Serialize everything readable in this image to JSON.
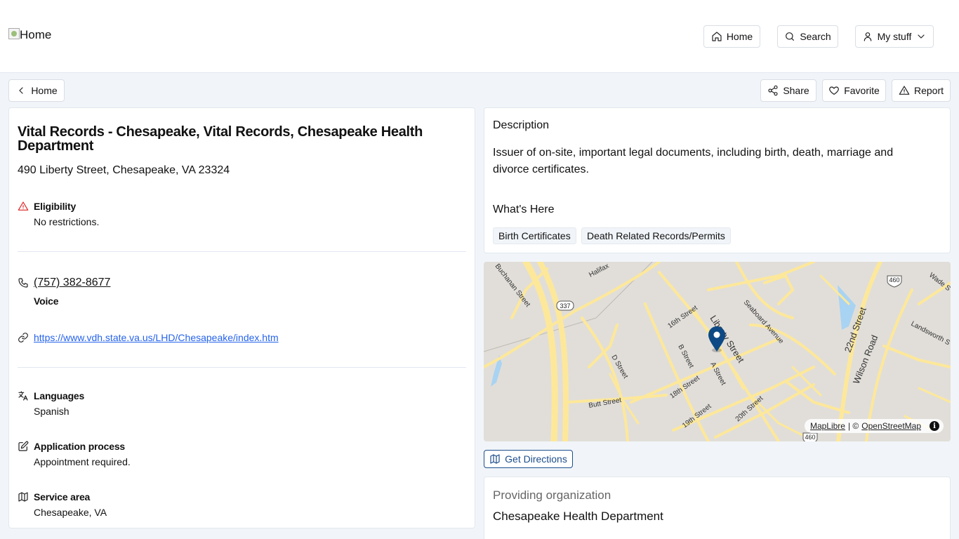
{
  "header": {
    "logo_alt": "Home",
    "nav": {
      "home": "Home",
      "search": "Search",
      "my_stuff": "My stuff"
    }
  },
  "toolbar": {
    "back": "Home",
    "share": "Share",
    "favorite": "Favorite",
    "report": "Report"
  },
  "service": {
    "title": "Vital Records - Chesapeake, Vital Records, Chesapeake Health Department",
    "address": "490 Liberty Street, Chesapeake, VA 23324",
    "eligibility_label": "Eligibility",
    "eligibility_value": "No restrictions.",
    "phone": "(757) 382-8677",
    "phone_type": "Voice",
    "website": "https://www.vdh.state.va.us/LHD/Chesapeake/index.htm",
    "languages_label": "Languages",
    "languages_value": "Spanish",
    "application_label": "Application process",
    "application_value": "Appointment required.",
    "service_area_label": "Service area",
    "service_area_value": "Chesapeake, VA"
  },
  "description": {
    "heading": "Description",
    "text": "Issuer of on-site, important legal documents, including birth, death, marriage and divorce certificates.",
    "whats_here_heading": "What's Here",
    "tags": [
      "Birth Certificates",
      "Death Related Records/Permits"
    ]
  },
  "map": {
    "streets": {
      "buchanan": "Buchanan Street",
      "halifax": "Halifax",
      "route337": "337",
      "sixteenth": "16th Street",
      "liberty": "Liberty Street",
      "seaboard": "Seaboard Avenue",
      "route460a": "460",
      "wade": "Wade S",
      "twentysecond": "22nd Street",
      "wilson": "Wilson Road",
      "landsworth": "Landsworth S",
      "bstreet": "B Street",
      "astreet": "A Street",
      "dstreet": "D Street",
      "eighteenth": "18th Street",
      "butt": "Butt Street",
      "nineteenth": "19th Street",
      "twentieth": "20th Street",
      "route460b": "460"
    },
    "attribution_maplibre": "MapLibre",
    "attribution_sep": " | © ",
    "attribution_osm": "OpenStreetMap",
    "info": "i",
    "road_color": "#fde89a",
    "land_color": "#e1ded9",
    "water_color": "#a9d3f2",
    "pin_color": "#0d4a85"
  },
  "actions": {
    "get_directions": "Get Directions"
  },
  "organization": {
    "heading": "Providing organization",
    "name": "Chesapeake Health Department"
  }
}
